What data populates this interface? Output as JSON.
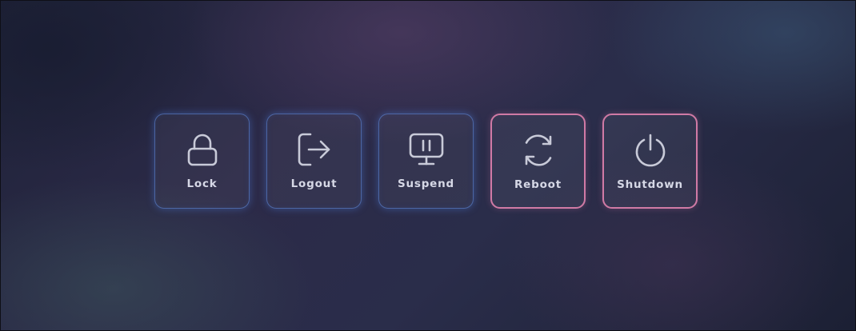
{
  "session_menu": {
    "actions": [
      {
        "label": "Lock",
        "icon": "lock-icon",
        "style": "normal"
      },
      {
        "label": "Logout",
        "icon": "logout-icon",
        "style": "normal"
      },
      {
        "label": "Suspend",
        "icon": "suspend-icon",
        "style": "normal"
      },
      {
        "label": "Reboot",
        "icon": "reboot-icon",
        "style": "danger"
      },
      {
        "label": "Shutdown",
        "icon": "power-icon",
        "style": "danger"
      }
    ]
  },
  "colors": {
    "normal_border": "#5a82d2",
    "danger_border": "#d07aa5",
    "label_text": "#d6d8e6",
    "icon_stroke": "#c8cad8"
  }
}
